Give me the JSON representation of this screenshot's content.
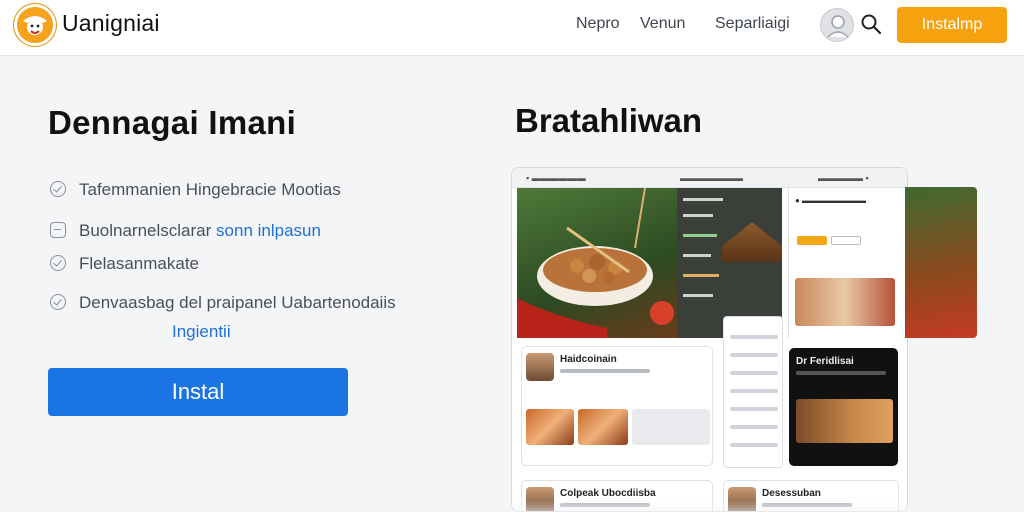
{
  "nav": {
    "brand": "Uanigniai",
    "links": [
      "Nepro",
      "Venun",
      "Separliaigi"
    ],
    "install_label": "Instalmp"
  },
  "hero": {
    "title": "Dennagai Imani",
    "features": [
      {
        "text": "Tafemmanien Hingebracie Mootias",
        "icon": "check-circle-icon"
      },
      {
        "text": "Buolnarnelsclarar",
        "link": "sonn inlpasun",
        "icon": "square-icon"
      },
      {
        "text": "Flelasanmakate",
        "icon": "check-circle-icon"
      },
      {
        "text": "Denvaasbag del praipanel Uabartenodaiis",
        "link": "Ingientii",
        "icon": "check-circle-icon"
      }
    ],
    "install_label": "Instal"
  },
  "preview": {
    "title": "Bratahliwan",
    "cards": [
      {
        "name": "Haidcoinain"
      },
      {
        "name": "Dr Feridlisai"
      },
      {
        "name": "Colpeak Ubocdiisba"
      },
      {
        "name": "Desessuban"
      }
    ]
  },
  "colors": {
    "accent_orange": "#f6a20f",
    "primary_blue": "#1b74e4",
    "link_blue": "#1f6fd6"
  }
}
